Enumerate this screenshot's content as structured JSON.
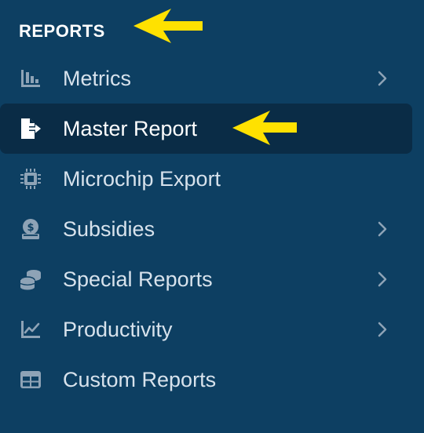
{
  "section": {
    "title": "REPORTS"
  },
  "menu": {
    "items": [
      {
        "label": "Metrics",
        "icon": "bar-chart-icon",
        "has_submenu": true,
        "active": false
      },
      {
        "label": "Master Report",
        "icon": "file-export-icon",
        "has_submenu": false,
        "active": true
      },
      {
        "label": "Microchip Export",
        "icon": "microchip-icon",
        "has_submenu": false,
        "active": false
      },
      {
        "label": "Subsidies",
        "icon": "money-bag-icon",
        "has_submenu": true,
        "active": false
      },
      {
        "label": "Special Reports",
        "icon": "coins-icon",
        "has_submenu": true,
        "active": false
      },
      {
        "label": "Productivity",
        "icon": "line-chart-icon",
        "has_submenu": true,
        "active": false
      },
      {
        "label": "Custom Reports",
        "icon": "table-icon",
        "has_submenu": false,
        "active": false
      }
    ]
  },
  "colors": {
    "background": "#0d3f62",
    "active_background": "#0a2c46",
    "icon": "#8ea3b6",
    "text": "#d7e2ec",
    "active_text": "#ffffff",
    "annotation_arrow": "#ffe100"
  }
}
